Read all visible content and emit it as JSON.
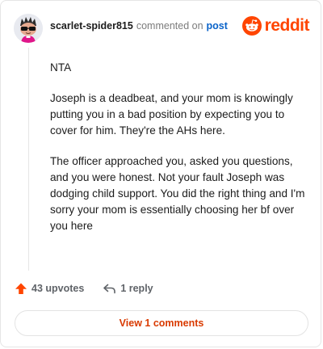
{
  "header": {
    "username": "scarlet-spider815",
    "action_text": "commented on",
    "post_link": "post",
    "brand_name": "reddit",
    "avatar_icon": "snoo-avatar-with-sunglasses",
    "brand_icon": "reddit-snoo-logo"
  },
  "comment": {
    "paragraphs": [
      "NTA",
      "Joseph is a deadbeat, and your mom is knowingly putting you in a bad position by expecting you to cover for him. They're the AHs here.",
      "The officer approached you, asked you questions, and you were honest. Not your fault Joseph was dodging child support. You did the right thing and I'm sorry your mom is essentially choosing her bf over you here"
    ]
  },
  "actions": {
    "upvotes_label": "43 upvotes",
    "reply_label": "1 reply",
    "upvote_icon": "upvote-arrow-icon",
    "reply_icon": "reply-arrow-icon"
  },
  "view_comments": {
    "label": "View 1 comments"
  },
  "colors": {
    "brand": "#ff4500",
    "link": "#0a63c9",
    "view_button_text": "#d93a00"
  }
}
